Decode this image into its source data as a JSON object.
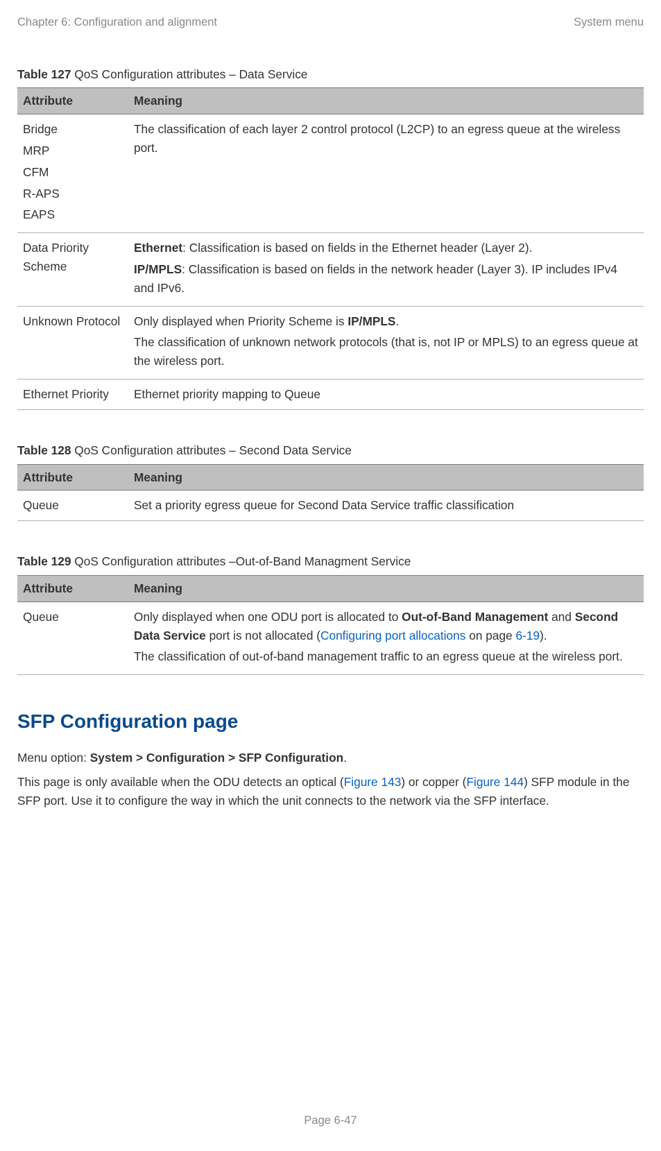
{
  "header": {
    "left": "Chapter 6:  Configuration and alignment",
    "right": "System menu"
  },
  "table127": {
    "label": "Table 127",
    "caption": "  QoS Configuration attributes – Data Service",
    "colAttr": "Attribute",
    "colMeaning": "Meaning",
    "rows": {
      "r0": {
        "attr": {
          "l0": "Bridge",
          "l1": "MRP",
          "l2": "CFM",
          "l3": "R-APS",
          "l4": "EAPS"
        },
        "meaning": "The classification of each layer 2 control protocol (L2CP) to an egress queue at the wireless port."
      },
      "r1": {
        "attr": "Data Priority Scheme",
        "eth_b": "Ethernet",
        "eth_t": ": Classification is based on fields in the Ethernet header (Layer 2).",
        "ip_b": "IP/MPLS",
        "ip_t": ": Classification is based on fields in the network header (Layer 3). IP includes IPv4 and IPv6."
      },
      "r2": {
        "attr": "Unknown Protocol",
        "p1a": "Only displayed when Priority Scheme is ",
        "p1b": "IP/MPLS",
        "p1c": ".",
        "p2": "The classification of unknown network protocols (that is, not IP or MPLS) to an egress queue at the wireless port."
      },
      "r3": {
        "attr": "Ethernet Priority",
        "meaning": "Ethernet priority mapping to Queue"
      }
    }
  },
  "table128": {
    "label": "Table 128",
    "caption": "  QoS Configuration attributes – Second Data Service",
    "colAttr": "Attribute",
    "colMeaning": "Meaning",
    "row": {
      "attr": "Queue",
      "meaning": "Set a priority egress queue for Second Data Service traffic classification"
    }
  },
  "table129": {
    "label": "Table 129",
    "caption": "  QoS Configuration attributes –Out-of-Band Managment Service",
    "colAttr": "Attribute",
    "colMeaning": "Meaning",
    "row": {
      "attr": "Queue",
      "p1a": "Only displayed when one ODU port is allocated to ",
      "p1b": "Out-of-Band Management",
      "p1c": " and ",
      "p1d": "Second Data Service",
      "p1e": " port is not allocated (",
      "p1link": "Configuring port allocations",
      "p1f": " on page ",
      "p1page": "6-19",
      "p1g": ").",
      "p2": "The classification of out-of-band management traffic to an egress queue at the wireless port."
    }
  },
  "section": {
    "heading": "SFP Configuration page",
    "l1a": "Menu option: ",
    "l1b": "System > Configuration > SFP Configuration",
    "l1c": ".",
    "l2a": "This page is only available when the ODU detects an optical (",
    "l2fig1": "Figure 143",
    "l2b": ") or copper (",
    "l2fig2": "Figure 144",
    "l2c": ") SFP module in the SFP port. Use it to configure the way in which the unit connects to the network via the SFP interface."
  },
  "footer": "Page 6-47"
}
